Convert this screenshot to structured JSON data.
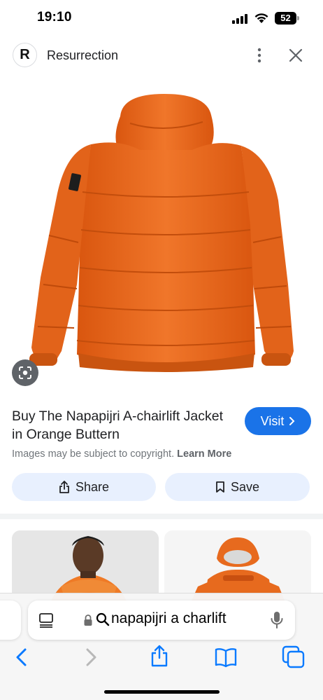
{
  "status_bar": {
    "time": "19:10",
    "battery": "52"
  },
  "header": {
    "logo_letter": "R",
    "source_name": "Resurrection"
  },
  "product": {
    "title": "Buy The Napapijri A-chairlift Jacket in Orange Buttern",
    "visit_label": "Visit",
    "copyright_text": "Images may be subject to copyright.",
    "learn_more_label": "Learn More",
    "image_color": "#ee6b1f"
  },
  "actions": {
    "share_label": "Share",
    "save_label": "Save"
  },
  "address_bar": {
    "text": "napapijri a charlift"
  },
  "colors": {
    "accent": "#1a73e8",
    "action_bg": "#e8f0fe",
    "ios_blue": "#0a7aff"
  }
}
